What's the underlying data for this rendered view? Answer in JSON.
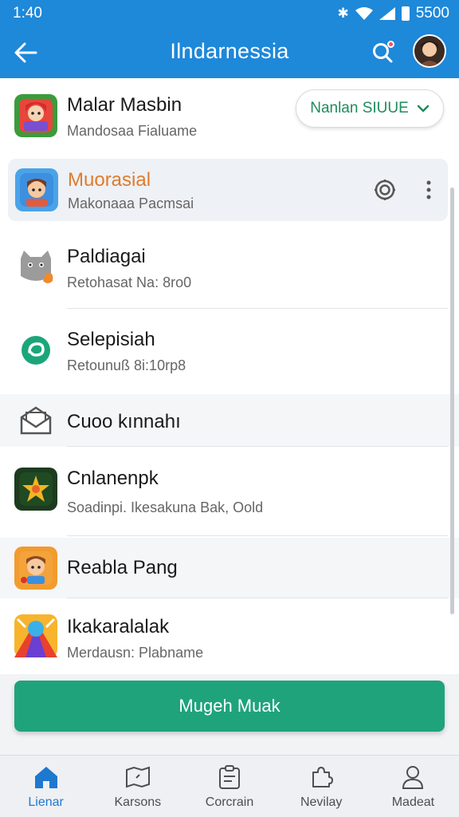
{
  "status_bar": {
    "time": "1:40",
    "battery_label": "5500",
    "icons": [
      "bluetooth-icon",
      "wifi-icon",
      "signal-icon",
      "battery-icon"
    ]
  },
  "app_bar": {
    "title": "Ilndarnessia",
    "back_icon": "back-arrow-icon",
    "search_icon": "search-icon",
    "avatar_icon": "avatar"
  },
  "colors": {
    "primary": "#1e88d9",
    "accent_orange": "#e07b2c",
    "button_green": "#1fa37b",
    "chip_text": "#1f8b5f"
  },
  "list": {
    "items": [
      {
        "title": "Malar Masbin",
        "subtitle": "Mandosaa Fialuame",
        "icon": "game-character-icon"
      },
      {
        "title": "Muorasial",
        "subtitle": "Makonaaa Pacmsai",
        "icon": "boy-character-icon",
        "highlighted": true
      },
      {
        "title": "Paldiagai",
        "subtitle": "Retohasat Na: 8ro0",
        "icon": "cat-icon"
      },
      {
        "title": "Selepisiah",
        "subtitle": "Retounuß 8i:10rp8",
        "icon": "green-circle-icon"
      },
      {
        "title": "Cuoo kınnahı",
        "subtitle": "",
        "icon": "mail-icon"
      },
      {
        "title": "Cnlanenpk",
        "subtitle": "Soadinpi. Ikesakuna Bak, Oold",
        "icon": "star-game-icon"
      },
      {
        "title": "Reabla Pang",
        "subtitle": "",
        "icon": "kid-character-icon"
      },
      {
        "title": "Ikakaralalak",
        "subtitle": "Merdausn: Plabname",
        "icon": "colorful-game-icon"
      }
    ],
    "chip_button": {
      "label": "Nanlan SIUUE",
      "icon": "chevron-down-icon"
    },
    "row_actions": [
      "settings-gear-icon",
      "more-vertical-icon"
    ]
  },
  "primary_button": {
    "label": "Mugeh Muak"
  },
  "bottom_nav": {
    "items": [
      {
        "label": "Lienar",
        "icon": "home-icon",
        "active": true
      },
      {
        "label": "Karsons",
        "icon": "map-icon",
        "active": false
      },
      {
        "label": "Corcrain",
        "icon": "clipboard-icon",
        "active": false
      },
      {
        "label": "Nevilay",
        "icon": "puzzle-icon",
        "active": false
      },
      {
        "label": "Madeat",
        "icon": "person-icon",
        "active": false
      }
    ]
  }
}
